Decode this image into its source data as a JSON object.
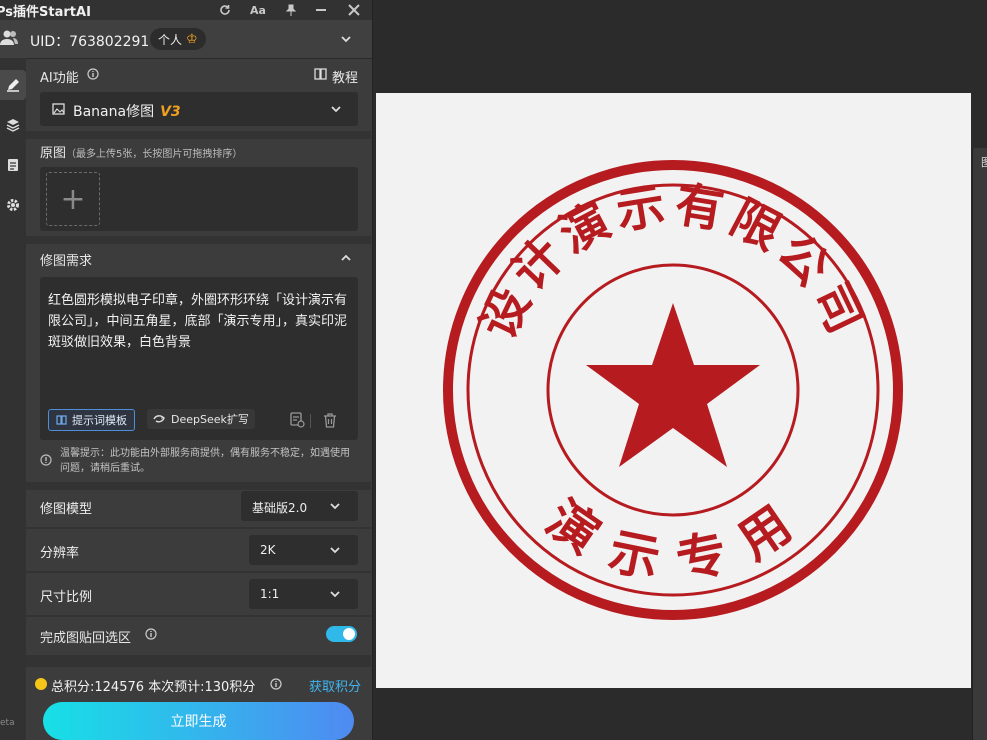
{
  "app": {
    "title": "Ps插件StartAI",
    "title_icons": [
      "refresh-icon",
      "font-size-icon",
      "pin-icon",
      "minimize-icon",
      "close-icon"
    ],
    "font_icon_text": "Aa"
  },
  "user": {
    "uid_text": "UID：763802291",
    "badge_label": "个人",
    "crown": "♔"
  },
  "sidebar": {
    "items": [
      "edit-icon",
      "layers-icon",
      "history-icon",
      "settings-icon"
    ]
  },
  "ai_function": {
    "label": "AI功能",
    "tutorial": "教程",
    "selected_model": "Banana修图",
    "version": "V3"
  },
  "source": {
    "label": "原图",
    "hint": "（最多上传5张，长按图片可拖拽排序）",
    "add_symbol": "+"
  },
  "requirements": {
    "label": "修图需求",
    "text": "红色圆形模拟电子印章，外圈环形环绕「设计演示有限公司」，中间五角星，底部「演示专用」，真实印泥斑驳做旧效果，白色背景",
    "template_button": "提示词模板",
    "deepseek_button": "DeepSeek扩写",
    "note": "温馨提示：此功能由外部服务商提供，偶有服务不稳定，如遇使用问题，请稍后重试。"
  },
  "options": {
    "model_label": "修图模型",
    "model_value": "基础版2.0",
    "resolution_label": "分辨率",
    "resolution_value": "2K",
    "ratio_label": "尺寸比例",
    "ratio_value": "1:1",
    "paste_back_label": "完成图贴回选区",
    "paste_back_enabled": true
  },
  "footer": {
    "points_text": "总积分:124576  本次预计:130积分",
    "get_points": "获取积分",
    "generate": "立即生成",
    "beta_text": "eta"
  },
  "stamp": {
    "ring_text": "设计演示有限公司",
    "bottom_text": "演示专用",
    "color": "#b51b1f"
  },
  "right_panel": {
    "tab_text": "图"
  }
}
